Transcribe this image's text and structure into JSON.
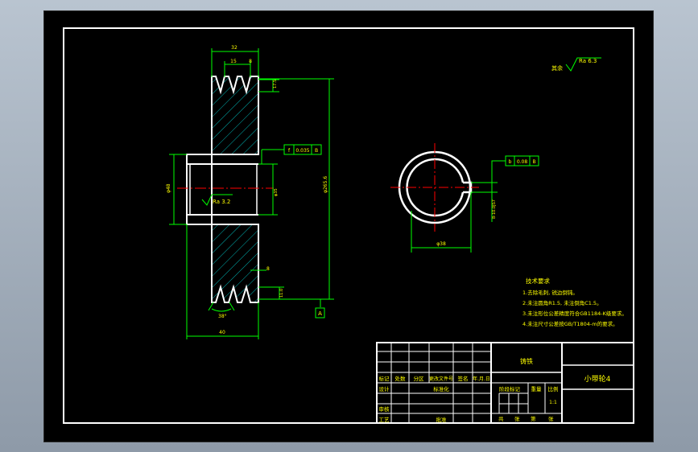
{
  "colors": {
    "background": "#000000",
    "frame": "#ffffff",
    "dimension": "#00ff00",
    "center_line": "#ff0000",
    "annotation": "#ffff00",
    "hatch": "#00ffff"
  },
  "part_view": {
    "dims": {
      "top_width": "32",
      "groove_pitch": "15",
      "groove_half": "8",
      "groove_depth_top": "17.5",
      "groove_depth_bottom": "11.0",
      "overall_diameter": "φ265.6",
      "bore_diameter": "φ35",
      "hub_diameter": "φ48",
      "bottom_width": "40",
      "groove_angle": "38°",
      "bottom_small": "8",
      "roughness": "Ra 3.2"
    },
    "tolerance_frame": [
      "f",
      "0.035",
      "B"
    ],
    "datum_label": "A"
  },
  "side_view": {
    "dims": {
      "keyway_width": "8-10.0JS7",
      "outer_diameter": "φ38"
    },
    "tolerance_frame": [
      "b",
      "0.08",
      "B"
    ]
  },
  "roughness_global": {
    "label": "其余",
    "value": "Ra 6.3"
  },
  "tech_requirements": {
    "title": "技术要求",
    "items": [
      "1.去除毛刺, 锐边倒钝。",
      "2.未注圆角R1.5, 未注倒角C1.5。",
      "3.未注形位公差精度符合GB1184-K级要求。",
      "4.未注尺寸公差按GB/T1804-m的要求。"
    ]
  },
  "title_block": {
    "material": "铸铁",
    "part_name": "小带轮4",
    "row_headers": [
      "标记",
      "处数",
      "分区",
      "更改文件号",
      "签名",
      "年.月.日"
    ],
    "design": "设计",
    "standardize": "标准化",
    "stage_marks": "阶段标记",
    "weight": "重量",
    "scale": "比例",
    "scale_value": "1:1",
    "review": "审核",
    "process": "工艺",
    "approve": "批准",
    "sheets": [
      "共",
      "张",
      "第",
      "张"
    ]
  }
}
